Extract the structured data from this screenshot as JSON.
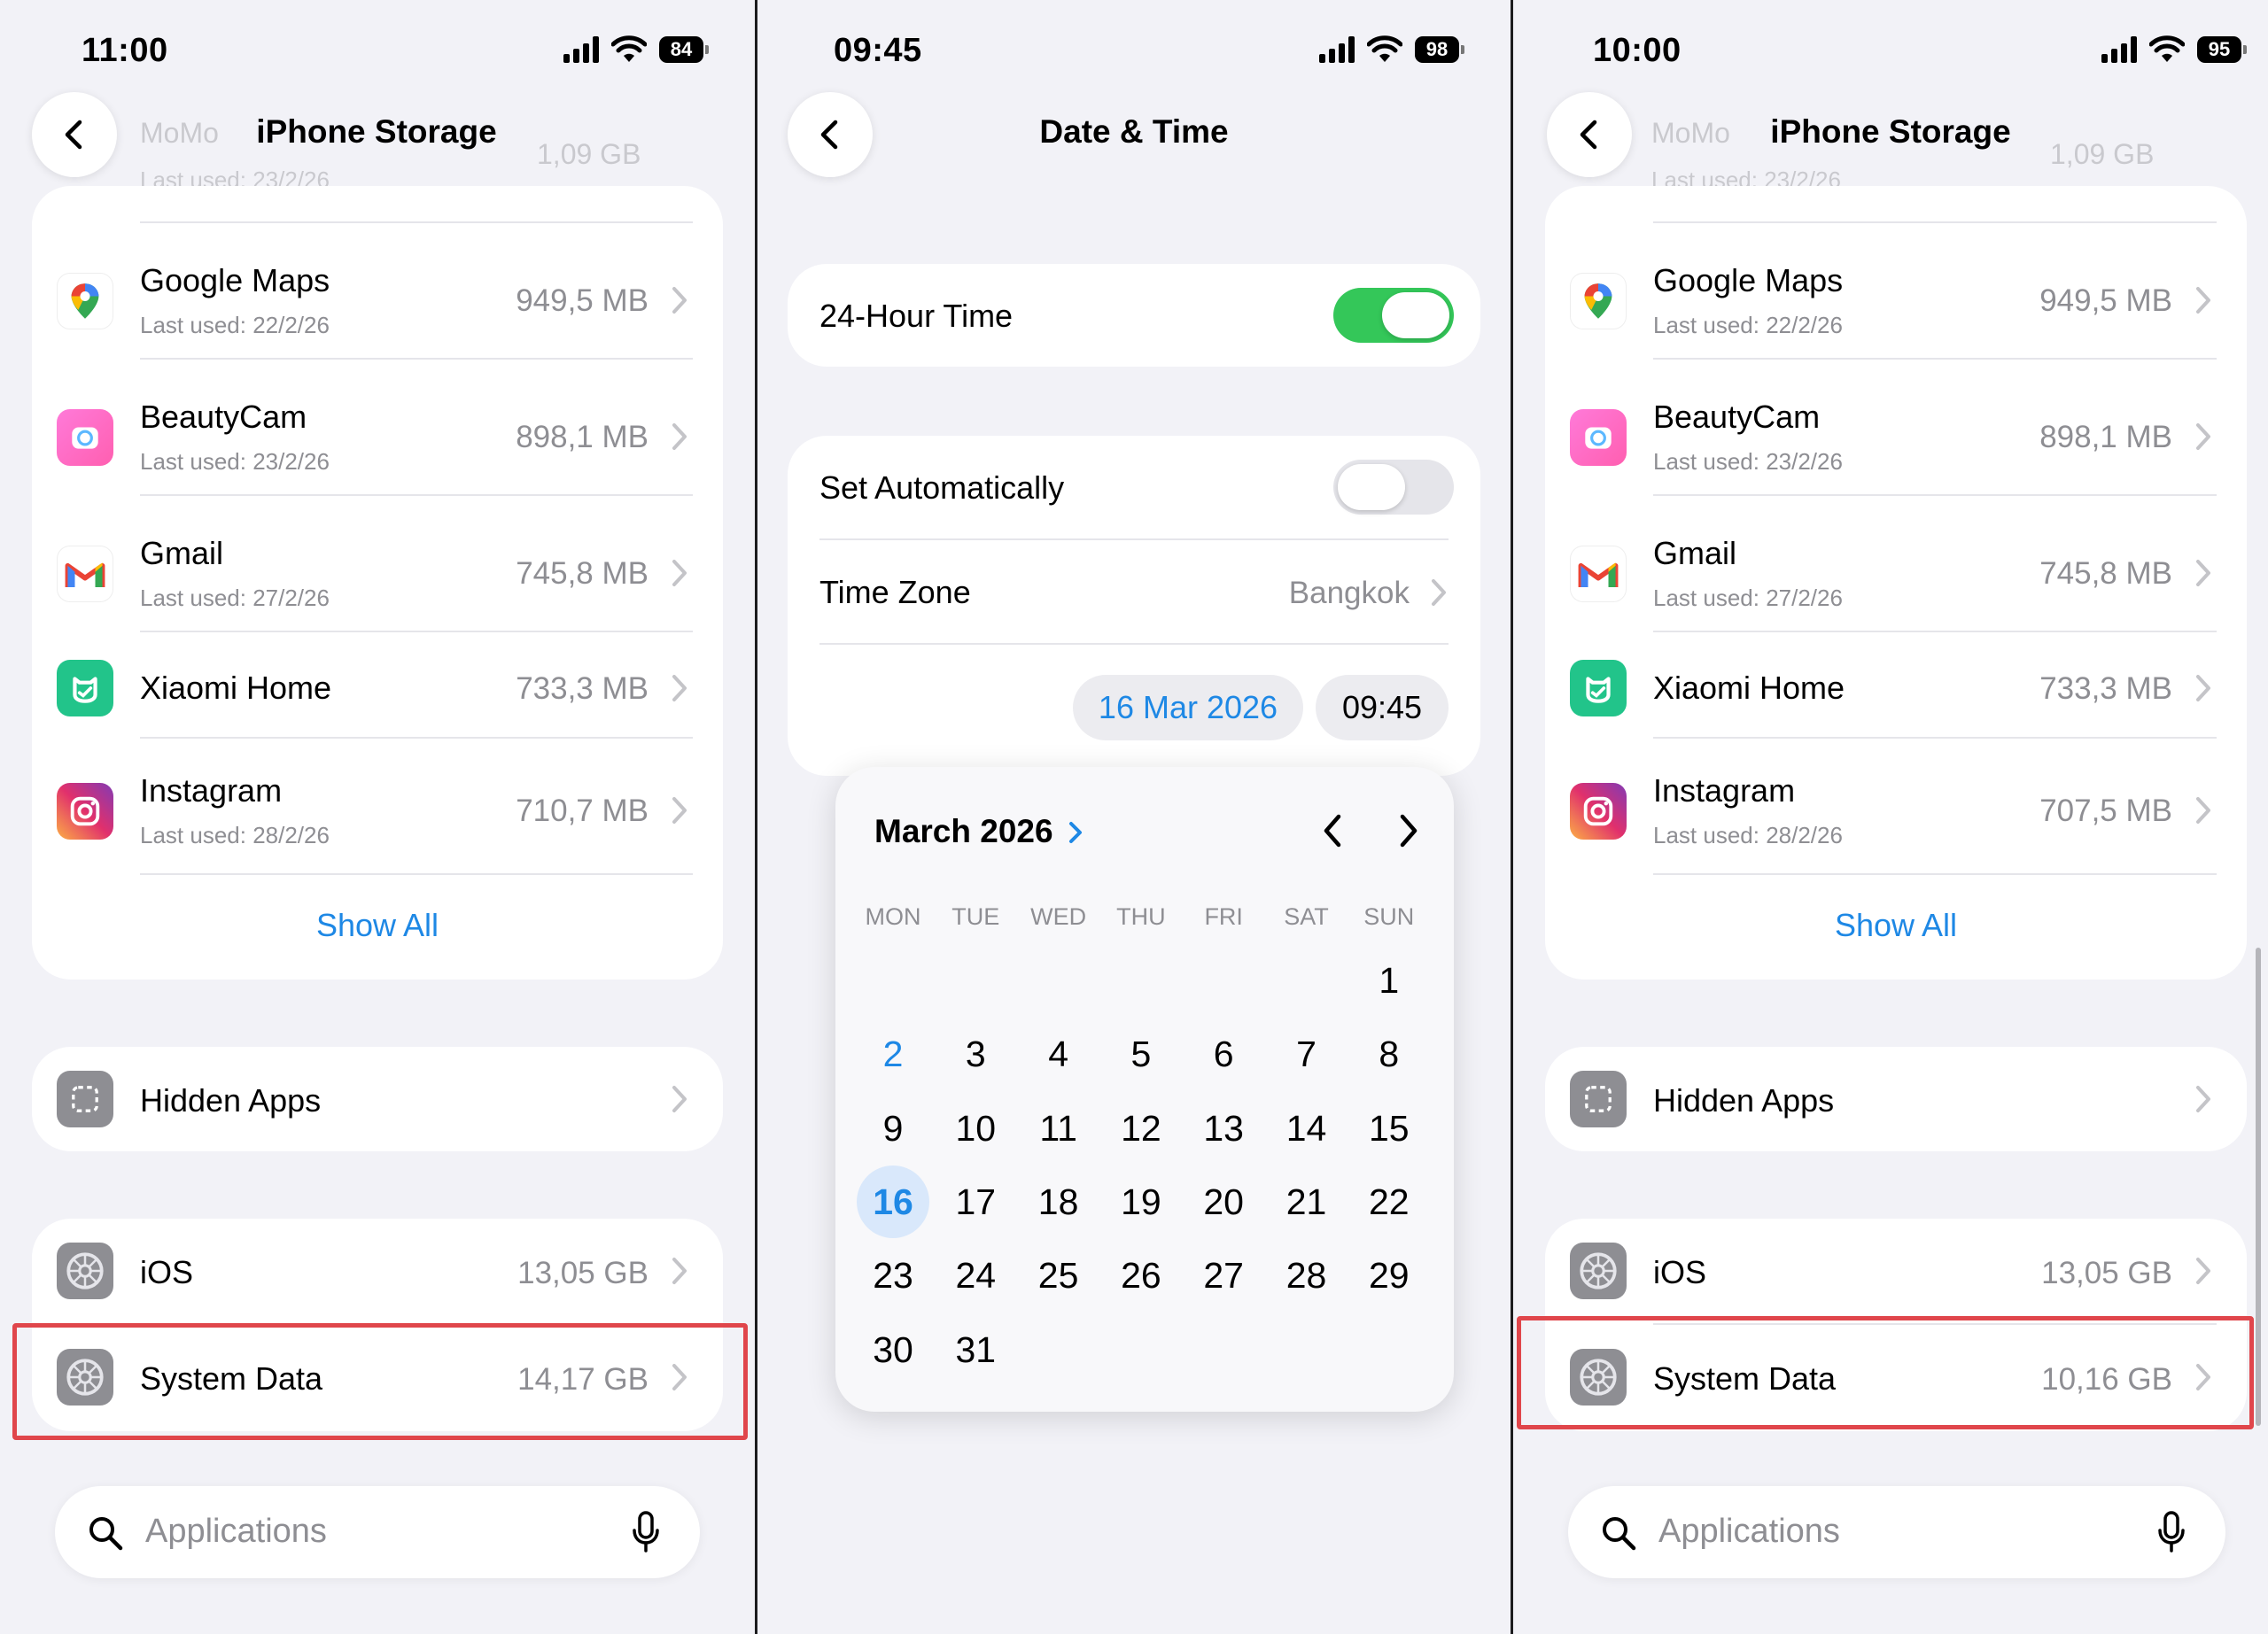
{
  "panel1": {
    "status": {
      "time": "11:00",
      "battery": "84"
    },
    "nav": {
      "title": "iPhone Storage"
    },
    "ghost_row": {
      "title": "MoMo",
      "subtitle": "Last used: 23/2/26",
      "size": "1,09 GB"
    },
    "apps": [
      {
        "name": "Google Maps",
        "last_used": "Last used: 22/2/26",
        "size": "949,5 MB",
        "icon": "google-maps-icon"
      },
      {
        "name": "BeautyCam",
        "last_used": "Last used: 23/2/26",
        "size": "898,1 MB",
        "icon": "beautycam-icon"
      },
      {
        "name": "Gmail",
        "last_used": "Last used: 27/2/26",
        "size": "745,8 MB",
        "icon": "gmail-icon"
      },
      {
        "name": "Xiaomi Home",
        "last_used": "",
        "size": "733,3 MB",
        "icon": "xiaomi-home-icon"
      },
      {
        "name": "Instagram",
        "last_used": "Last used: 28/2/26",
        "size": "710,7 MB",
        "icon": "instagram-icon"
      }
    ],
    "show_all": "Show All",
    "hidden_apps": "Hidden Apps",
    "ios": {
      "label": "iOS",
      "size": "13,05 GB"
    },
    "system_data": {
      "label": "System Data",
      "size": "14,17 GB"
    },
    "search_placeholder": "Applications"
  },
  "panel2": {
    "status": {
      "time": "09:45",
      "battery": "98"
    },
    "nav": {
      "title": "Date & Time"
    },
    "hour24": {
      "label": "24-Hour Time",
      "on": true
    },
    "set_auto": {
      "label": "Set Automatically",
      "on": false
    },
    "timezone": {
      "label": "Time Zone",
      "value": "Bangkok"
    },
    "date_pill": "16 Mar 2026",
    "time_pill": "09:45",
    "calendar": {
      "month_title": "March 2026",
      "weekdays": [
        "MON",
        "TUE",
        "WED",
        "THU",
        "FRI",
        "SAT",
        "SUN"
      ],
      "first_weekday_index": 6,
      "days_in_month": 31,
      "selected_day": 16,
      "highlight_day": 2
    }
  },
  "panel3": {
    "status": {
      "time": "10:00",
      "battery": "95"
    },
    "nav": {
      "title": "iPhone Storage"
    },
    "ghost_row": {
      "title": "MoMo",
      "subtitle": "Last used: 23/2/26",
      "size": "1,09 GB"
    },
    "apps": [
      {
        "name": "Google Maps",
        "last_used": "Last used: 22/2/26",
        "size": "949,5 MB",
        "icon": "google-maps-icon"
      },
      {
        "name": "BeautyCam",
        "last_used": "Last used: 23/2/26",
        "size": "898,1 MB",
        "icon": "beautycam-icon"
      },
      {
        "name": "Gmail",
        "last_used": "Last used: 27/2/26",
        "size": "745,8 MB",
        "icon": "gmail-icon"
      },
      {
        "name": "Xiaomi Home",
        "last_used": "",
        "size": "733,3 MB",
        "icon": "xiaomi-home-icon"
      },
      {
        "name": "Instagram",
        "last_used": "Last used: 28/2/26",
        "size": "707,5 MB",
        "icon": "instagram-icon"
      }
    ],
    "show_all": "Show All",
    "hidden_apps": "Hidden Apps",
    "ios": {
      "label": "iOS",
      "size": "13,05 GB"
    },
    "system_data": {
      "label": "System Data",
      "size": "10,16 GB"
    },
    "search_placeholder": "Applications"
  },
  "colors": {
    "accent": "#1e88e5",
    "toggle_on": "#34c759",
    "highlight": "#e0464b"
  }
}
